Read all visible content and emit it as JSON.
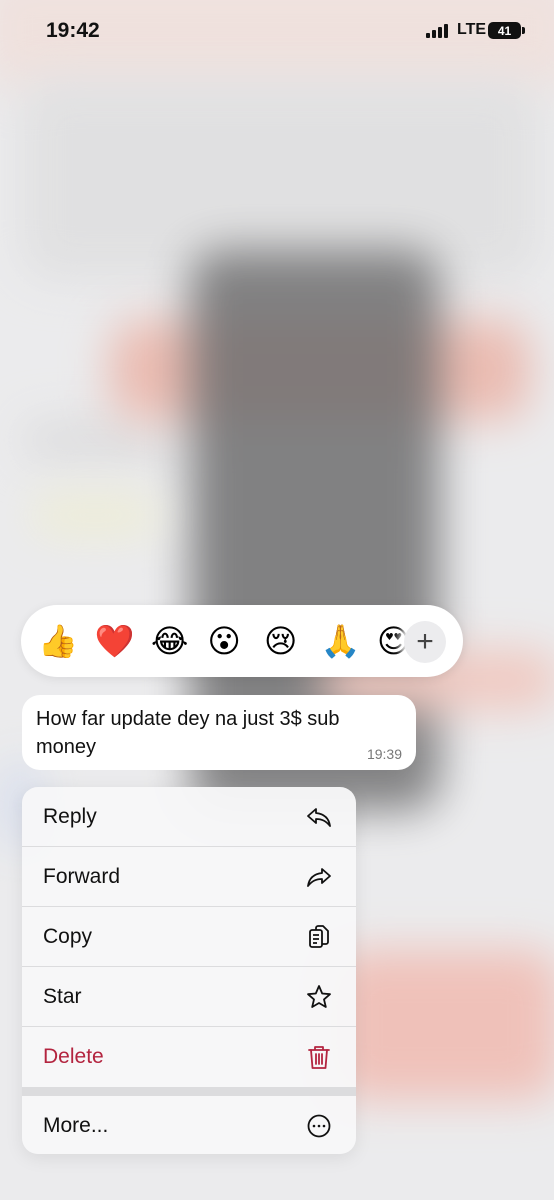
{
  "status_bar": {
    "time": "19:42",
    "network": "LTE",
    "battery": "41"
  },
  "reactions": {
    "emojis": [
      "👍",
      "❤️",
      "😂",
      "😮",
      "😢",
      "🙏",
      "😍"
    ],
    "more_label": "+"
  },
  "message": {
    "text": "How far update dey na just 3$ sub money",
    "time": "19:39"
  },
  "menu": {
    "items": [
      {
        "label": "Reply",
        "icon": "reply-icon"
      },
      {
        "label": "Forward",
        "icon": "forward-icon"
      },
      {
        "label": "Copy",
        "icon": "copy-icon"
      },
      {
        "label": "Star",
        "icon": "star-icon"
      },
      {
        "label": "Delete",
        "icon": "trash-icon"
      },
      {
        "label": "More...",
        "icon": "more-icon"
      }
    ]
  },
  "colors": {
    "delete": "#b3243f",
    "bubble": "#ffffff",
    "menu_bg": "#f7f7f8"
  }
}
